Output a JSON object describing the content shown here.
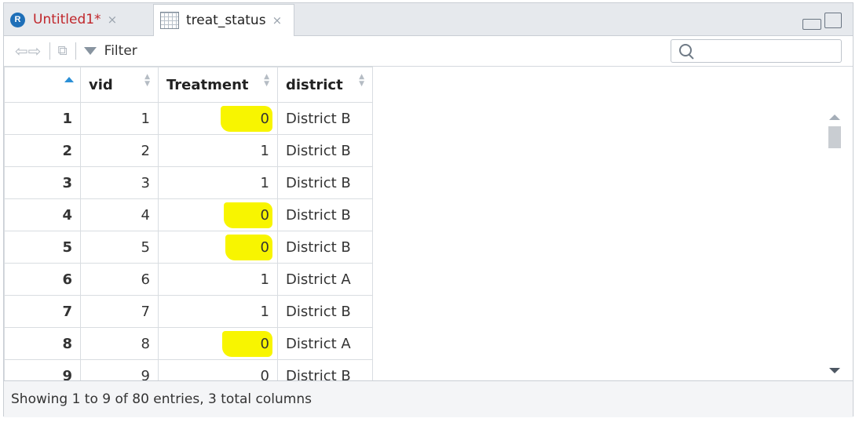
{
  "tabs": [
    {
      "label": "Untitled1*",
      "close": "×",
      "icon": "r-script-icon",
      "unsaved": true
    },
    {
      "label": "treat_status",
      "close": "×",
      "icon": "data-grid-icon",
      "active": true
    }
  ],
  "toolbar": {
    "filter_label": "Filter",
    "search_placeholder": ""
  },
  "table": {
    "columns": [
      "",
      "vid",
      "Treatment",
      "district"
    ],
    "rows": [
      {
        "row": "1",
        "vid": "1",
        "treatment": "0",
        "district": "District B",
        "highlight": true
      },
      {
        "row": "2",
        "vid": "2",
        "treatment": "1",
        "district": "District B",
        "highlight": false
      },
      {
        "row": "3",
        "vid": "3",
        "treatment": "1",
        "district": "District B",
        "highlight": false
      },
      {
        "row": "4",
        "vid": "4",
        "treatment": "0",
        "district": "District B",
        "highlight": true
      },
      {
        "row": "5",
        "vid": "5",
        "treatment": "0",
        "district": "District B",
        "highlight": true
      },
      {
        "row": "6",
        "vid": "6",
        "treatment": "1",
        "district": "District A",
        "highlight": false
      },
      {
        "row": "7",
        "vid": "7",
        "treatment": "1",
        "district": "District B",
        "highlight": false
      },
      {
        "row": "8",
        "vid": "8",
        "treatment": "0",
        "district": "District A",
        "highlight": true
      },
      {
        "row": "9",
        "vid": "9",
        "treatment": "0",
        "district": "District B",
        "highlight": false
      }
    ]
  },
  "footer": {
    "status": "Showing 1 to 9 of 80 entries, 3 total columns"
  },
  "colors": {
    "highlight": "#f8f500",
    "unsaved_tab": "#c0262b",
    "sort_active": "#2b8fd6"
  }
}
